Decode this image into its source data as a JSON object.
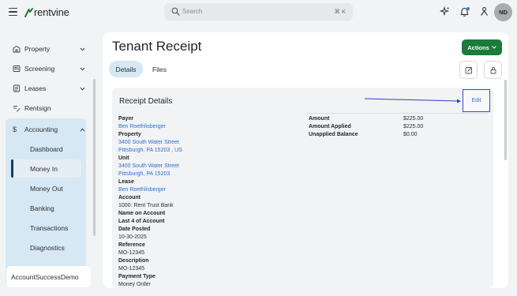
{
  "app": {
    "logo_text": "rentvine",
    "search_placeholder": "Search",
    "search_shortcut": "⌘ K",
    "avatar_initials": "ND",
    "brand_color": "#1d7a3a"
  },
  "sidebar": {
    "items": [
      {
        "label": "Property",
        "icon": "building-icon"
      },
      {
        "label": "Screening",
        "icon": "screening-icon"
      },
      {
        "label": "Leases",
        "icon": "lease-icon"
      },
      {
        "label": "Rentsign",
        "icon": "rentsign-icon"
      },
      {
        "label": "Accounting",
        "icon": "dollar-icon"
      }
    ],
    "accounting_sub": [
      {
        "label": "Dashboard"
      },
      {
        "label": "Money In"
      },
      {
        "label": "Money Out"
      },
      {
        "label": "Banking"
      },
      {
        "label": "Transactions"
      },
      {
        "label": "Diagnostics"
      }
    ],
    "active_sub": "Money In",
    "account_name": "AccountSuccessDemo"
  },
  "page": {
    "title": "Tenant Receipt",
    "actions_label": "Actions",
    "tabs": [
      {
        "label": "Details",
        "active": true
      },
      {
        "label": "Files",
        "active": false
      }
    ]
  },
  "receipt": {
    "section_title": "Receipt Details",
    "edit_label": "Edit",
    "fields": [
      {
        "label": "Payer",
        "values": [
          "Ben Roethlisberger"
        ],
        "link": true
      },
      {
        "label": "Property",
        "values": [
          "3400 South Water Street",
          "Pittsburgh, PA 15203 , US"
        ],
        "link": true
      },
      {
        "label": "Unit",
        "values": [
          "3400 South Water Street",
          "Pittsburgh, PA 15203"
        ],
        "link": true
      },
      {
        "label": "Lease",
        "values": [
          "Ben Roethlisberger"
        ],
        "link": true
      },
      {
        "label": "Account",
        "values": [
          "1000: Rent Trust Bank"
        ],
        "link": false
      },
      {
        "label": "Name on Account",
        "values": [],
        "link": false
      },
      {
        "label": "Last 4 of Account",
        "values": [],
        "link": false
      },
      {
        "label": "Date Posted",
        "values": [
          "10-30-2025"
        ],
        "link": false
      },
      {
        "label": "Reference",
        "values": [
          "MO-12345"
        ],
        "link": false
      },
      {
        "label": "Description",
        "values": [
          "MO-12345"
        ],
        "link": false
      },
      {
        "label": "Payment Type",
        "values": [
          "Money Order"
        ],
        "link": false
      }
    ],
    "amounts": [
      {
        "label": "Amount",
        "value": "$225.00"
      },
      {
        "label": "Amount Applied",
        "value": "$225.00"
      },
      {
        "label": "Unapplied Balance",
        "value": "$0.00"
      }
    ]
  }
}
